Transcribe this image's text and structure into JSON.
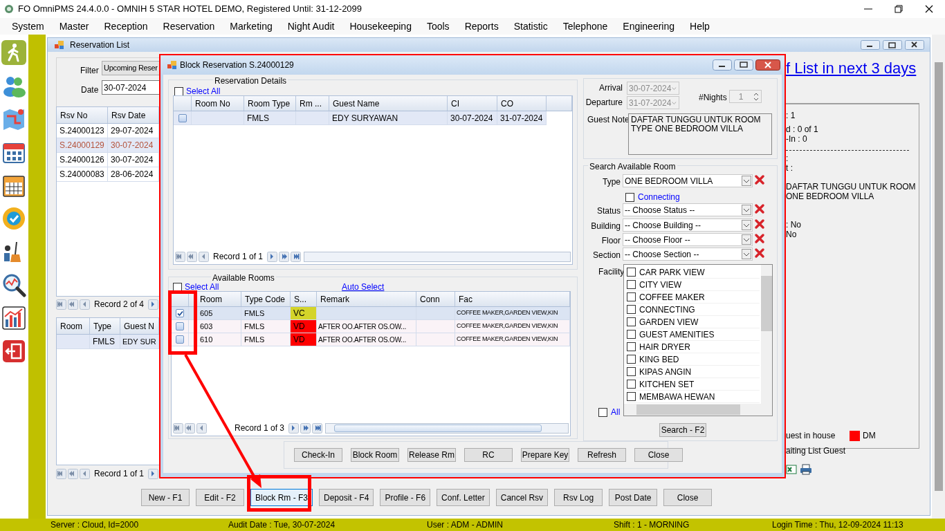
{
  "app_title": "FO OmniPMS 24.4.0.0 - OMNIH 5 STAR HOTEL DEMO, Registered Until: 31-12-2099",
  "menu": [
    "System",
    "Master",
    "Reception",
    "Reservation",
    "Marketing",
    "Night Audit",
    "Housekeeping",
    "Tools",
    "Reports",
    "Statistic",
    "Telephone",
    "Engineering",
    "Help"
  ],
  "reservation_list": {
    "title": "Reservation List",
    "filter_label": "Filter",
    "filter_value": "Upcoming Reser",
    "date_label": "Date",
    "date_value": "30-07-2024",
    "rsv_table": {
      "columns": [
        "Rsv No",
        "Rsv Date"
      ],
      "rows": [
        {
          "cells": [
            "S.24000123",
            "29-07-2024"
          ],
          "selected": false
        },
        {
          "cells": [
            "S.24000129",
            "30-07-2024"
          ],
          "selected": true
        },
        {
          "cells": [
            "S.24000126",
            "30-07-2024"
          ],
          "selected": false
        },
        {
          "cells": [
            "S.24000083",
            "28-06-2024"
          ],
          "selected": false
        }
      ],
      "record": "Record 2 of 4"
    },
    "room_table": {
      "columns": [
        "Room",
        "Type",
        "Guest N"
      ],
      "rows": [
        {
          "type": "FMLS",
          "guest": "EDY SUR"
        }
      ],
      "record": "Record 1 of 1"
    },
    "link": "f List in next 3 days",
    "summary_lines": [
      ": 1",
      "d : 0 of 1",
      "-In : 0",
      ":",
      "t :",
      "DAFTAR TUNGGU UNTUK ROOM",
      "ONE BEDROOM VILLA",
      ": No",
      "No"
    ],
    "legend": [
      {
        "label": "uest in house"
      },
      {
        "label": "DM",
        "color": "#ff0000"
      },
      {
        "label": "aiting List Guest"
      }
    ],
    "buttons": [
      {
        "label": "New - F1",
        "selected": false
      },
      {
        "label": "Edit - F2",
        "selected": false
      },
      {
        "label": "Block Rm - F3",
        "selected": true
      },
      {
        "label": "Deposit - F4",
        "selected": false
      },
      {
        "label": "Profile  - F6",
        "selected": false
      },
      {
        "label": "Conf. Letter",
        "selected": false
      },
      {
        "label": "Cancel Rsv",
        "selected": false
      },
      {
        "label": "Rsv Log",
        "selected": false
      },
      {
        "label": "Post Date",
        "selected": false
      },
      {
        "label": "Close",
        "selected": false
      }
    ]
  },
  "block_reservation": {
    "title": "Block Reservation S.24000129",
    "reservation_details": {
      "title": "Reservation Details",
      "select_all": {
        "label": "Select All",
        "checked": false
      },
      "columns": [
        "Room No",
        "Room Type",
        "Rm ...",
        "Guest Name",
        "CI",
        "CO"
      ],
      "rows": [
        {
          "checked": false,
          "selected": true,
          "room_type": "FMLS",
          "guest_name": "EDY SURYAWAN",
          "ci": "30-07-2024",
          "co": "31-07-2024"
        }
      ],
      "record": "Record 1 of 1"
    },
    "available_rooms": {
      "title": "Available Rooms",
      "select_all": {
        "label": "Select All",
        "checked": false
      },
      "auto_select": "Auto Select",
      "columns": [
        "Room",
        "Type Code",
        "S...",
        "Remark",
        "Conn",
        "Fac"
      ],
      "rows": [
        {
          "checked": true,
          "selected": true,
          "room": "605",
          "type_code": "FMLS",
          "status": "VC",
          "color": "#d4d42a",
          "fac": "COFFEE MAKER,GARDEN VIEW,KIN"
        },
        {
          "checked": false,
          "selected": false,
          "room": "603",
          "type_code": "FMLS",
          "status": "VD",
          "color": "#ff0000",
          "remark": "AFTER OO.AFTER OS.OW...",
          "fac": "COFFEE MAKER,GARDEN VIEW,KIN"
        },
        {
          "checked": false,
          "selected": false,
          "room": "610",
          "type_code": "FMLS",
          "status": "VD",
          "color": "#ff0000",
          "remark": "AFTER OO.AFTER OS.OW...",
          "fac": "COFFEE MAKER,GARDEN VIEW,KIN"
        }
      ],
      "record": "Record 1 of 3"
    },
    "buttons": [
      "Check-In",
      "Block Room",
      "Release Rm",
      "RC",
      "Prepare Key",
      "Refresh",
      "Close"
    ],
    "arrival": {
      "label": "Arrival",
      "value": "30-07-2024",
      "disabled": true
    },
    "departure": {
      "label": "Departure",
      "value": "31-07-2024",
      "disabled": true
    },
    "nights": {
      "label": "#Nights",
      "value": "1",
      "disabled": true
    },
    "guest_note": {
      "label": "Guest Note",
      "value": "DAFTAR TUNGGU UNTUK ROOM TYPE ONE BEDROOM VILLA"
    },
    "search": {
      "title": "Search Available Room",
      "filters": [
        {
          "label": "Type",
          "value": "ONE BEDROOM VILLA"
        },
        {
          "label": "Status",
          "value": "-- Choose Status --"
        },
        {
          "label": "Building",
          "value": "-- Choose Building --"
        },
        {
          "label": "Floor",
          "value": "-- Choose Floor --"
        },
        {
          "label": "Section",
          "value": "-- Choose Section --"
        }
      ],
      "connecting": {
        "label": "Connecting",
        "checked": false
      },
      "facility_label": "Facility",
      "facilities": [
        {
          "label": "CAR PARK VIEW",
          "checked": false
        },
        {
          "label": "CITY VIEW",
          "checked": false
        },
        {
          "label": "COFFEE MAKER",
          "checked": false
        },
        {
          "label": "CONNECTING",
          "checked": false
        },
        {
          "label": "GARDEN VIEW",
          "checked": false
        },
        {
          "label": "GUEST AMENITIES",
          "checked": false
        },
        {
          "label": "HAIR DRYER",
          "checked": false
        },
        {
          "label": "KING BED",
          "checked": false
        },
        {
          "label": "KIPAS ANGIN",
          "checked": false
        },
        {
          "label": "KITCHEN SET",
          "checked": false
        },
        {
          "label": "MEMBAWA HEWAN",
          "checked": false
        }
      ],
      "all": {
        "label": "All",
        "checked": false
      },
      "search_button": "Search - F2"
    }
  },
  "status_bar": [
    "Server : Cloud, Id=2000",
    "Audit Date : Tue, 30-07-2024",
    "User : ADM - ADMIN",
    "Shift : 1 - MORNING",
    "Login Time : Thu, 12-09-2024 11:13"
  ]
}
